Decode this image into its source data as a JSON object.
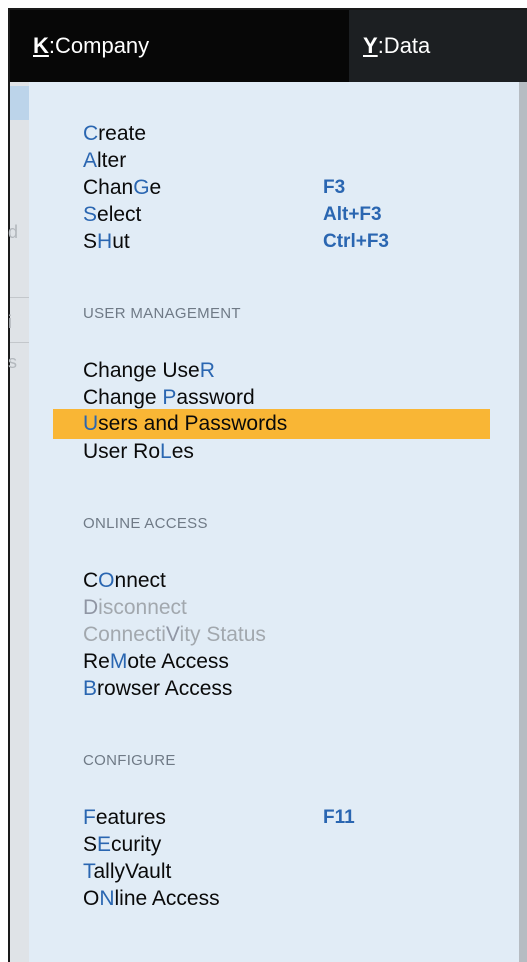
{
  "topbar": {
    "company": {
      "key": "K",
      "label": ":Company"
    },
    "data": {
      "key": "Y",
      "label": ":Data"
    }
  },
  "menu": {
    "items": [
      {
        "pre": "",
        "hk": "C",
        "post": "reate",
        "shortcut": "",
        "disabled": false
      },
      {
        "pre": "",
        "hk": "A",
        "post": "lter",
        "shortcut": "",
        "disabled": false
      },
      {
        "pre": "Chan",
        "hk": "G",
        "post": "e",
        "shortcut": "F3",
        "disabled": false
      },
      {
        "pre": "",
        "hk": "S",
        "post": "elect",
        "shortcut": "Alt+F3",
        "disabled": false
      },
      {
        "pre": "S",
        "hk": "H",
        "post": "ut",
        "shortcut": "Ctrl+F3",
        "disabled": false
      },
      {
        "pre": "Change Use",
        "hk": "R",
        "post": "",
        "shortcut": "",
        "disabled": false
      },
      {
        "pre": "Change ",
        "hk": "P",
        "post": "assword",
        "shortcut": "",
        "disabled": false
      },
      {
        "pre": "",
        "hk": "U",
        "post": "sers and Passwords",
        "shortcut": "",
        "disabled": false
      },
      {
        "pre": "User Ro",
        "hk": "L",
        "post": "es",
        "shortcut": "",
        "disabled": false
      },
      {
        "pre": "C",
        "hk": "O",
        "post": "nnect",
        "shortcut": "",
        "disabled": false
      },
      {
        "pre": "",
        "hk": "D",
        "post": "isconnect",
        "shortcut": "",
        "disabled": true
      },
      {
        "pre": "Connecti",
        "hk": "V",
        "post": "ity Status",
        "shortcut": "",
        "disabled": true
      },
      {
        "pre": "Re",
        "hk": "M",
        "post": "ote Access",
        "shortcut": "",
        "disabled": false
      },
      {
        "pre": "",
        "hk": "B",
        "post": "rowser Access",
        "shortcut": "",
        "disabled": false
      },
      {
        "pre": "",
        "hk": "F",
        "post": "eatures",
        "shortcut": "F11",
        "disabled": false
      },
      {
        "pre": "S",
        "hk": "E",
        "post": "curity",
        "shortcut": "",
        "disabled": false
      },
      {
        "pre": "",
        "hk": "T",
        "post": "allyVault",
        "shortcut": "",
        "disabled": false
      },
      {
        "pre": "O",
        "hk": "N",
        "post": "line Access",
        "shortcut": "",
        "disabled": false
      }
    ],
    "sections": [
      "USER MANAGEMENT",
      "ONLINE ACCESS",
      "CONFIGURE"
    ],
    "highlighted_item": "Users and Passwords"
  },
  "colors": {
    "highlight": "#f9b635",
    "hotkey": "#2a66b1",
    "menu_bg": "#e1ecf6",
    "topbar_bg": "#070707"
  }
}
